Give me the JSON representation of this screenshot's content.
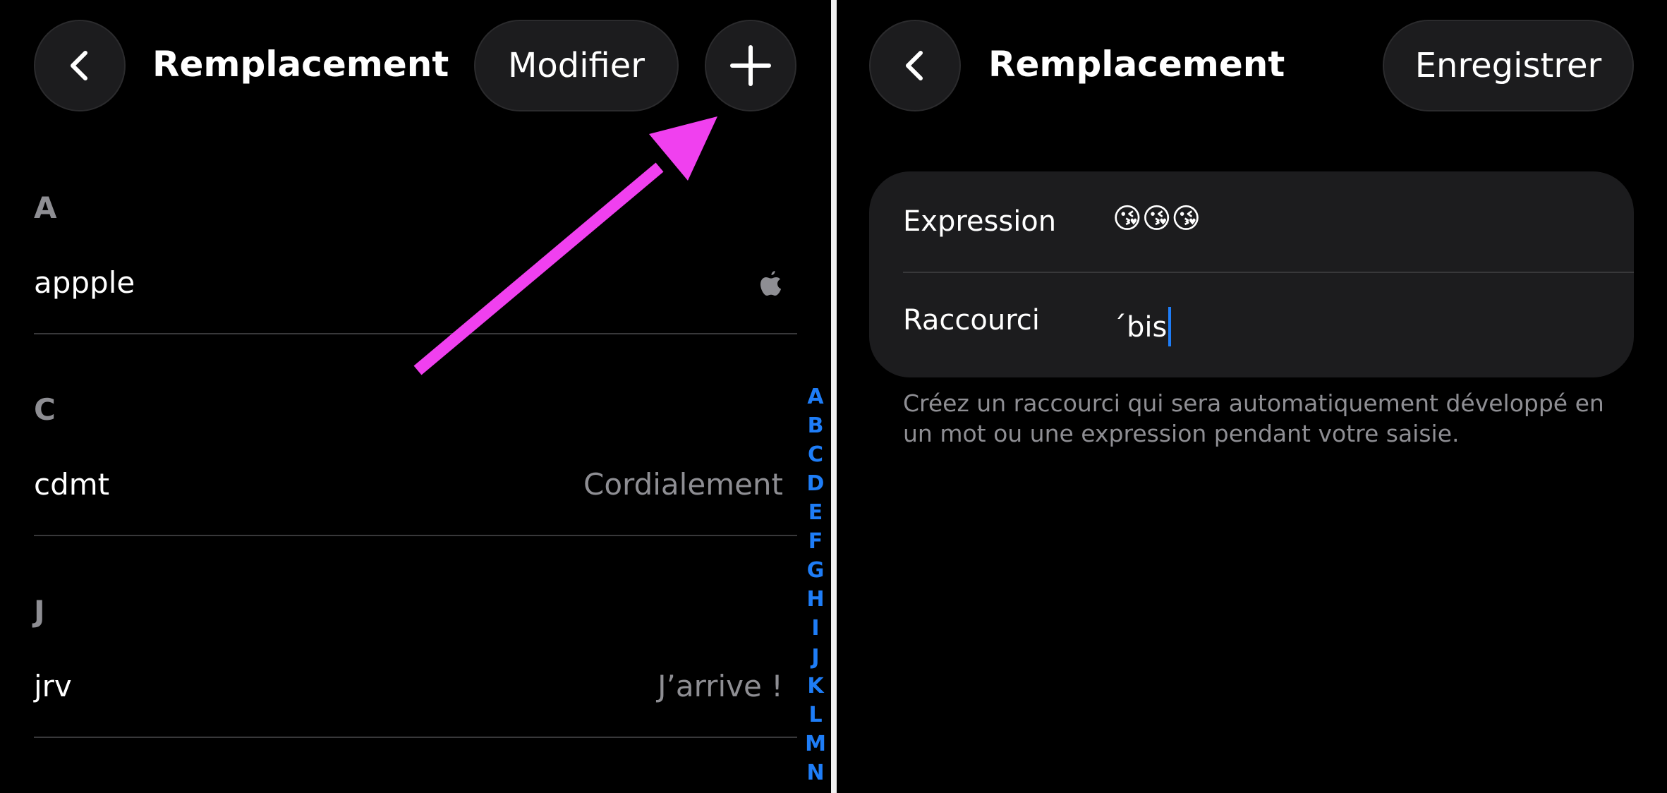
{
  "left_screen": {
    "title": "Remplacement",
    "back_icon": "chevron-left-icon",
    "edit_label": "Modifier",
    "add_icon": "plus-icon",
    "sections": [
      {
        "letter": "A",
        "phrase": "appple",
        "shortcut_icon": "apple-logo-icon",
        "shortcut": ""
      },
      {
        "letter": "C",
        "phrase": "cdmt",
        "shortcut": "Cordialement"
      },
      {
        "letter": "J",
        "phrase": "jrv",
        "shortcut": "J’arrive !"
      }
    ],
    "index": [
      "A",
      "B",
      "C",
      "D",
      "E",
      "F",
      "G",
      "H",
      "I",
      "J",
      "K",
      "L",
      "M",
      "N"
    ]
  },
  "annotation": {
    "arrow_color": "#f040ef"
  },
  "right_screen": {
    "title": "Remplacement",
    "back_icon": "chevron-left-icon",
    "save_label": "Enregistrer",
    "expression_label": "Expression",
    "expression_value": "😘😘😘",
    "shortcut_label": "Raccourci",
    "shortcut_value": "´bis",
    "footer": "Créez un raccourci qui sera automatiquement développé en un mot ou une expression pendant votre saisie."
  },
  "colors": {
    "accent": "#1e7df7",
    "background": "#000000",
    "card": "#1c1c1e",
    "secondary_text": "#8e8e93"
  }
}
